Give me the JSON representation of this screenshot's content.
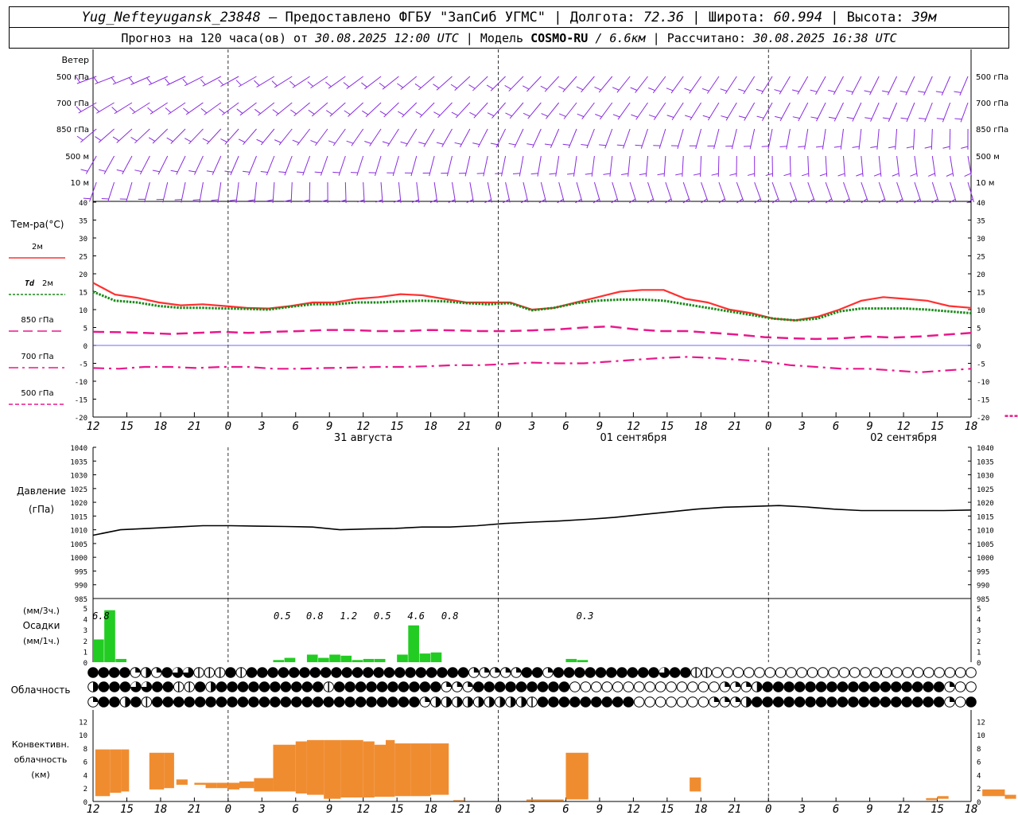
{
  "header": {
    "station": "Yug_Nefteyugansk_23848",
    "dash": " – ",
    "provider": "Предоставлено ФГБУ \"ЗапСиб УГМС\"",
    "sep": " | ",
    "lon_label": "Долгота: ",
    "lon": "72.36",
    "lat_label": "Широта: ",
    "lat": "60.994",
    "alt_label": "Высота: ",
    "alt": "39м",
    "forecast_prefix": "Прогноз на 120 часа(ов) от ",
    "forecast_time": "30.08.2025 12:00 UTC",
    "model_label": "Модель ",
    "model": "COSMO-RU",
    "resolution": " / 6.6км",
    "calc_label": "Рассчитано: ",
    "calc_time": "30.08.2025 16:38 UTC"
  },
  "colors": {
    "wind": "#8a2be2",
    "t2m": "#ff3030",
    "td2m": "#1a8a1a",
    "t850": "#e8198b",
    "t700": "#e8198b",
    "t500": "#e8198b",
    "zero_line": "#3a3aff",
    "pressure": "#000000",
    "precip": "#22cc22",
    "convective": "#f08c30"
  },
  "chart_data": [
    {
      "type": "wind_barbs",
      "title": "Ветер",
      "levels": [
        "500 гПа",
        "700 гПа",
        "850 гПа",
        "500 м",
        "10 м"
      ]
    },
    {
      "type": "line",
      "title": "Тем-ра(°C)",
      "ylim": [
        -20,
        40
      ],
      "yticks": [
        40,
        35,
        30,
        25,
        20,
        15,
        10,
        5,
        0,
        -5,
        -10,
        -15,
        -20
      ],
      "x_ticks": [
        "12",
        "15",
        "18",
        "21",
        "0",
        "3",
        "6",
        "9",
        "12",
        "15",
        "18",
        "21",
        "0",
        "3",
        "6",
        "9",
        "12",
        "15",
        "18",
        "21",
        "0",
        "3",
        "6",
        "9",
        "12",
        "15",
        "18"
      ],
      "date_labels": [
        {
          "text": "31 августа",
          "tick": 8
        },
        {
          "text": "01 сентября",
          "tick": 16
        },
        {
          "text": "02 сентября",
          "tick": 24
        }
      ],
      "legend": [
        {
          "name": "2м"
        },
        {
          "name": "Td",
          "suffix": "2м"
        },
        {
          "name": "850 гПа"
        },
        {
          "name": "700 гПа"
        },
        {
          "name": "500 гПа"
        }
      ],
      "series": [
        {
          "name": "2м",
          "step_h": 3,
          "values": [
            17.5,
            14.2,
            13.3,
            12.0,
            11.2,
            11.5,
            11.0,
            10.5,
            10.3,
            11.0,
            12.0,
            12.0,
            13.0,
            13.5,
            14.3,
            14.0,
            13.0,
            12.0,
            12.0,
            12.0,
            10.0,
            10.5,
            12.0,
            13.5,
            15.0,
            15.5,
            15.5,
            13.0,
            12.0,
            10.0,
            9.0,
            7.5,
            7.0,
            8.0,
            10.0,
            12.5,
            13.5,
            13.0,
            12.5,
            11.0,
            10.5
          ]
        },
        {
          "name": "Td 2м",
          "step_h": 3,
          "values": [
            15.0,
            12.5,
            12.0,
            11.0,
            10.5,
            10.5,
            10.3,
            10.2,
            10.0,
            10.8,
            11.5,
            11.5,
            12.0,
            12.0,
            12.3,
            12.5,
            12.3,
            11.8,
            11.5,
            11.8,
            9.8,
            10.5,
            11.8,
            12.5,
            12.8,
            12.8,
            12.5,
            11.5,
            10.5,
            9.5,
            8.5,
            7.5,
            7.0,
            7.5,
            9.5,
            10.3,
            10.3,
            10.3,
            10.0,
            9.5,
            9.0
          ]
        },
        {
          "name": "850 гПа",
          "step_h": 3,
          "values": [
            3.8,
            3.7,
            3.5,
            3.2,
            3.5,
            3.8,
            3.5,
            3.8,
            4.0,
            4.3,
            4.3,
            4.0,
            4.0,
            4.3,
            4.2,
            4.0,
            4.0,
            4.2,
            4.5,
            5.0,
            5.3,
            4.5,
            4.0,
            4.0,
            3.5,
            3.0,
            2.3,
            2.0,
            1.8,
            2.0,
            2.5,
            2.2,
            2.5,
            3.0,
            3.5
          ]
        },
        {
          "name": "700 гПа",
          "step_h": 3,
          "values": [
            -6.3,
            -6.5,
            -6.0,
            -6.0,
            -6.3,
            -6.0,
            -6.0,
            -6.5,
            -6.5,
            -6.3,
            -6.2,
            -6.0,
            -6.0,
            -5.8,
            -5.5,
            -5.5,
            -5.2,
            -4.8,
            -5.0,
            -5.0,
            -4.5,
            -4.0,
            -3.5,
            -3.2,
            -3.5,
            -4.0,
            -4.5,
            -5.5,
            -6.0,
            -6.5,
            -6.5,
            -7.0,
            -7.5,
            -7.0,
            -6.5
          ]
        },
        {
          "name": "500 гПа",
          "step_h": 3,
          "x_start_h": 81,
          "x_end_h": 90,
          "values": [
            -19.7,
            -19.7,
            -19.7,
            -19.7
          ]
        }
      ]
    },
    {
      "type": "line",
      "title": "Давление",
      "unit": "(гПа)",
      "ylim": [
        985,
        1040
      ],
      "yticks": [
        1040,
        1035,
        1030,
        1025,
        1020,
        1015,
        1010,
        1005,
        1000,
        995,
        990,
        985
      ],
      "series": [
        {
          "name": "pressure",
          "step_h": 3,
          "values": [
            1008.0,
            1010.0,
            1010.5,
            1011.0,
            1011.5,
            1011.5,
            1011.3,
            1011.2,
            1011.0,
            1010.0,
            1010.3,
            1010.5,
            1011.0,
            1011.0,
            1011.5,
            1012.3,
            1012.8,
            1013.2,
            1013.8,
            1014.5,
            1015.5,
            1016.5,
            1017.5,
            1018.2,
            1018.5,
            1018.8,
            1018.3,
            1017.5,
            1017.0,
            1017.0,
            1017.0,
            1017.0,
            1017.2
          ]
        }
      ]
    },
    {
      "type": "bar",
      "title": "Осадки",
      "unit_top": "(мм/3ч.)",
      "unit_bottom": "(мм/1ч.)",
      "ylim": [
        0,
        5
      ],
      "yticks": [
        5,
        4,
        3,
        2,
        1,
        0
      ],
      "hourly_bars": [
        {
          "h": 0,
          "v": 2.1
        },
        {
          "h": 1,
          "v": 4.8
        },
        {
          "h": 2,
          "v": 0.3
        },
        {
          "h": 16,
          "v": 0.2
        },
        {
          "h": 17,
          "v": 0.4
        },
        {
          "h": 19,
          "v": 0.7
        },
        {
          "h": 20,
          "v": 0.4
        },
        {
          "h": 21,
          "v": 0.7
        },
        {
          "h": 22,
          "v": 0.6
        },
        {
          "h": 23,
          "v": 0.2
        },
        {
          "h": 24,
          "v": 0.3
        },
        {
          "h": 25,
          "v": 0.3
        },
        {
          "h": 27,
          "v": 0.7
        },
        {
          "h": 28,
          "v": 3.4
        },
        {
          "h": 29,
          "v": 0.8
        },
        {
          "h": 30,
          "v": 0.9
        },
        {
          "h": 42,
          "v": 0.3
        },
        {
          "h": 43,
          "v": 0.2
        }
      ],
      "totals_3h": [
        {
          "text": "6.8",
          "h": 0.7
        },
        {
          "text": "0.5",
          "h": 16.8
        },
        {
          "text": "0.8",
          "h": 19.7
        },
        {
          "text": "1.2",
          "h": 22.7
        },
        {
          "text": "0.5",
          "h": 25.7
        },
        {
          "text": "4.6",
          "h": 28.7
        },
        {
          "text": "0.8",
          "h": 31.7
        },
        {
          "text": "0.3",
          "h": 43.7
        }
      ]
    },
    {
      "type": "cloud_symbols",
      "title": "Облачность",
      "rows": [
        "BBBBQHQBTTIIIBIBBBBBBBBBBBBBBBBBBBBBQQQQQBBQBBBBBBBBBBTBBIIOOOOOOOOOOOOOOOOOOOOOOOOO",
        "HBBBTTBBIIBHBBBBBBBBBBIBBBBBBBBBBQQQBBBBBBBBBOOOOOOOOOOOOOOQQQHBBBBBBBBBBBBBBBBBQOO",
        "QBBHBIBBBBBBBBBBBBBBBBBBBBBBBBBQHHHHHHHHHIBBBBBBBBBOOOOOOOQQQHBBBBBBBBBBBBBBBBBBQOB"
      ]
    },
    {
      "type": "bar",
      "title": "Конвективн. облачность",
      "unit": "(км)",
      "ylim": [
        0,
        13
      ],
      "yticks": [
        12,
        10,
        8,
        6,
        4,
        2,
        0
      ],
      "blocks": [
        {
          "h0": 0.2,
          "h1": 1.5,
          "base": 0.8,
          "top": 7.8
        },
        {
          "h0": 1.5,
          "h1": 2.5,
          "base": 1.3,
          "top": 7.8
        },
        {
          "h0": 2.5,
          "h1": 3.2,
          "base": 1.5,
          "top": 7.8
        },
        {
          "h0": 5.0,
          "h1": 6.3,
          "base": 1.8,
          "top": 7.3
        },
        {
          "h0": 6.3,
          "h1": 7.2,
          "base": 2.0,
          "top": 7.3
        },
        {
          "h0": 7.4,
          "h1": 8.4,
          "base": 2.5,
          "top": 3.3
        },
        {
          "h0": 9.0,
          "h1": 10.0,
          "base": 2.5,
          "top": 2.8
        },
        {
          "h0": 10.0,
          "h1": 11.0,
          "base": 2.0,
          "top": 2.8
        },
        {
          "h0": 11.0,
          "h1": 12.0,
          "base": 2.0,
          "top": 2.8
        },
        {
          "h0": 12.0,
          "h1": 13.0,
          "base": 1.8,
          "top": 2.8
        },
        {
          "h0": 13.0,
          "h1": 14.3,
          "base": 2.0,
          "top": 3.0
        },
        {
          "h0": 14.3,
          "h1": 16.0,
          "base": 1.5,
          "top": 3.5
        },
        {
          "h0": 16.0,
          "h1": 18.0,
          "base": 1.5,
          "top": 8.5
        },
        {
          "h0": 18.0,
          "h1": 19.0,
          "base": 1.2,
          "top": 9.0
        },
        {
          "h0": 19.0,
          "h1": 20.5,
          "base": 1.0,
          "top": 9.2
        },
        {
          "h0": 20.5,
          "h1": 22.0,
          "base": 0.4,
          "top": 9.2
        },
        {
          "h0": 22.0,
          "h1": 24.0,
          "base": 0.6,
          "top": 9.2
        },
        {
          "h0": 24.0,
          "h1": 25.0,
          "base": 0.6,
          "top": 9.0
        },
        {
          "h0": 25.0,
          "h1": 26.0,
          "base": 0.7,
          "top": 8.5
        },
        {
          "h0": 26.0,
          "h1": 26.8,
          "base": 0.7,
          "top": 9.2
        },
        {
          "h0": 26.8,
          "h1": 28.2,
          "base": 0.8,
          "top": 8.7
        },
        {
          "h0": 28.2,
          "h1": 30.0,
          "base": 0.8,
          "top": 8.7
        },
        {
          "h0": 30.0,
          "h1": 31.6,
          "base": 1.0,
          "top": 8.7
        },
        {
          "h0": 32.0,
          "h1": 33.0,
          "base": 0.1,
          "top": 0.2
        },
        {
          "h0": 38.5,
          "h1": 41.8,
          "base": 0.1,
          "top": 0.3
        },
        {
          "h0": 42.0,
          "h1": 44.0,
          "base": 0.3,
          "top": 7.3
        },
        {
          "h0": 53.0,
          "h1": 54.0,
          "base": 1.5,
          "top": 3.6
        },
        {
          "h0": 74.0,
          "h1": 75.0,
          "base": 0.2,
          "top": 0.5
        },
        {
          "h0": 75.0,
          "h1": 76.0,
          "base": 0.4,
          "top": 0.8
        },
        {
          "h0": 79.0,
          "h1": 81.0,
          "base": 0.8,
          "top": 1.8
        },
        {
          "h0": 81.0,
          "h1": 82.0,
          "base": 0.4,
          "top": 1.0
        }
      ]
    }
  ]
}
